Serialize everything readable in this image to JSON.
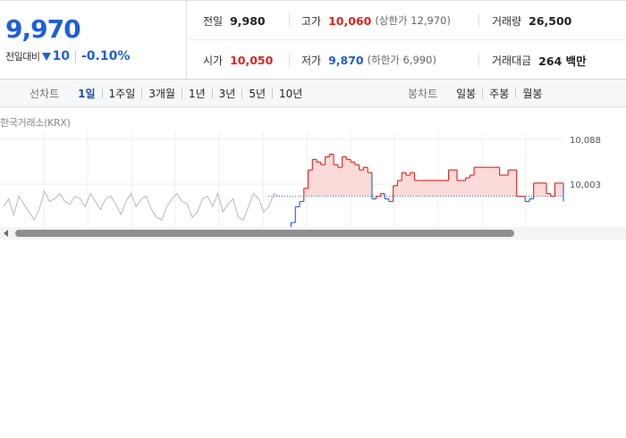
{
  "quote": {
    "price": "9,970",
    "change_label": "전일대비",
    "change_value": "10",
    "change_rate": "-0.10%",
    "row1": [
      {
        "label": "전일",
        "value": "9,980",
        "dir": ""
      },
      {
        "label": "고가",
        "value": "10,060",
        "dir": "up",
        "paren": "(상한가 12,970)"
      },
      {
        "label": "거래량",
        "value": "26,500",
        "dir": ""
      }
    ],
    "row2": [
      {
        "label": "시가",
        "value": "10,050",
        "dir": "up"
      },
      {
        "label": "저가",
        "value": "9,870",
        "dir": "down",
        "paren": "(하한가 6,990)"
      },
      {
        "label": "거래대금",
        "value": "264 백만",
        "dir": ""
      }
    ]
  },
  "tabs": {
    "line_title": "선차트",
    "line_periods": [
      "1일",
      "1주일",
      "3개월",
      "1년",
      "3년",
      "5년",
      "10년"
    ],
    "active_period": "1일",
    "candle_title": "봉차트",
    "candle_periods": [
      "일봉",
      "주봉",
      "월봉"
    ]
  },
  "source": "한국거래소(KRX)",
  "colors": {
    "up": "#e0221c",
    "down": "#1f5fd6",
    "prev_day": "#b8b8b8",
    "fill_up": "#fbdada"
  },
  "chart_data": {
    "type": "line",
    "y_tick_labels": [
      "10,088",
      "10,003"
    ],
    "y_ticks": [
      10088,
      10003
    ],
    "reference_value": 9980,
    "prev_day_series": [
      9960,
      9975,
      9945,
      9980,
      9965,
      9950,
      9935,
      9955,
      9990,
      9970,
      9975,
      9985,
      9970,
      9965,
      9980,
      9975,
      9960,
      9985,
      9970,
      9955,
      9975,
      9980,
      9965,
      9945,
      9970,
      9985,
      9960,
      9975,
      9980,
      9955,
      9940,
      9935,
      9960,
      9975,
      9985,
      9970,
      9965,
      9940,
      9950,
      9975,
      9980,
      9960,
      9985,
      9950,
      9965,
      9975,
      9940,
      9935,
      9960,
      9985,
      9975,
      9950,
      9960,
      9985,
      9980
    ],
    "series": [
      9900,
      9915,
      9930,
      9960,
      9970,
      9995,
      10030,
      10050,
      10045,
      10040,
      10055,
      10060,
      10040,
      10035,
      10055,
      10050,
      10045,
      10040,
      10030,
      10035,
      10025,
      9975,
      9980,
      9985,
      9975,
      9970,
      10000,
      10010,
      10025,
      10020,
      10025,
      10010,
      10010,
      10010,
      10010,
      10010,
      10010,
      10010,
      10010,
      10030,
      10030,
      10010,
      10010,
      10015,
      10020,
      10035,
      10035,
      10035,
      10035,
      10035,
      10035,
      10020,
      10020,
      10030,
      10030,
      9980,
      9980,
      9970,
      9975,
      10005,
      10005,
      10005,
      9985,
      9980,
      10005,
      10005,
      9970
    ]
  }
}
